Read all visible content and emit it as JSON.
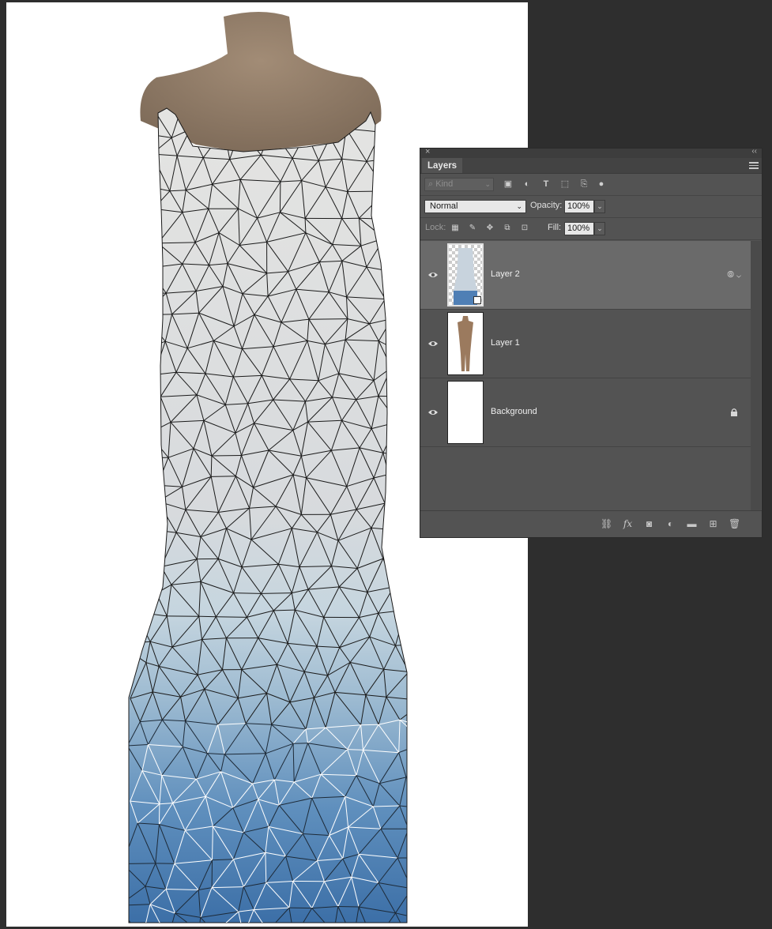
{
  "canvas": {
    "label": "Dress on mannequin with warp mesh"
  },
  "layers_panel": {
    "tab_title": "Layers",
    "filter": {
      "placeholder": "Kind"
    },
    "blend_mode": "Normal",
    "opacity_label": "Opacity:",
    "opacity_value": "100%",
    "lock_label": "Lock:",
    "fill_label": "Fill:",
    "fill_value": "100%",
    "layers": [
      {
        "name": "Layer 2",
        "visible": true,
        "selected": true
      },
      {
        "name": "Layer 1",
        "visible": true,
        "selected": false
      },
      {
        "name": "Background",
        "visible": true,
        "locked": true
      }
    ]
  }
}
